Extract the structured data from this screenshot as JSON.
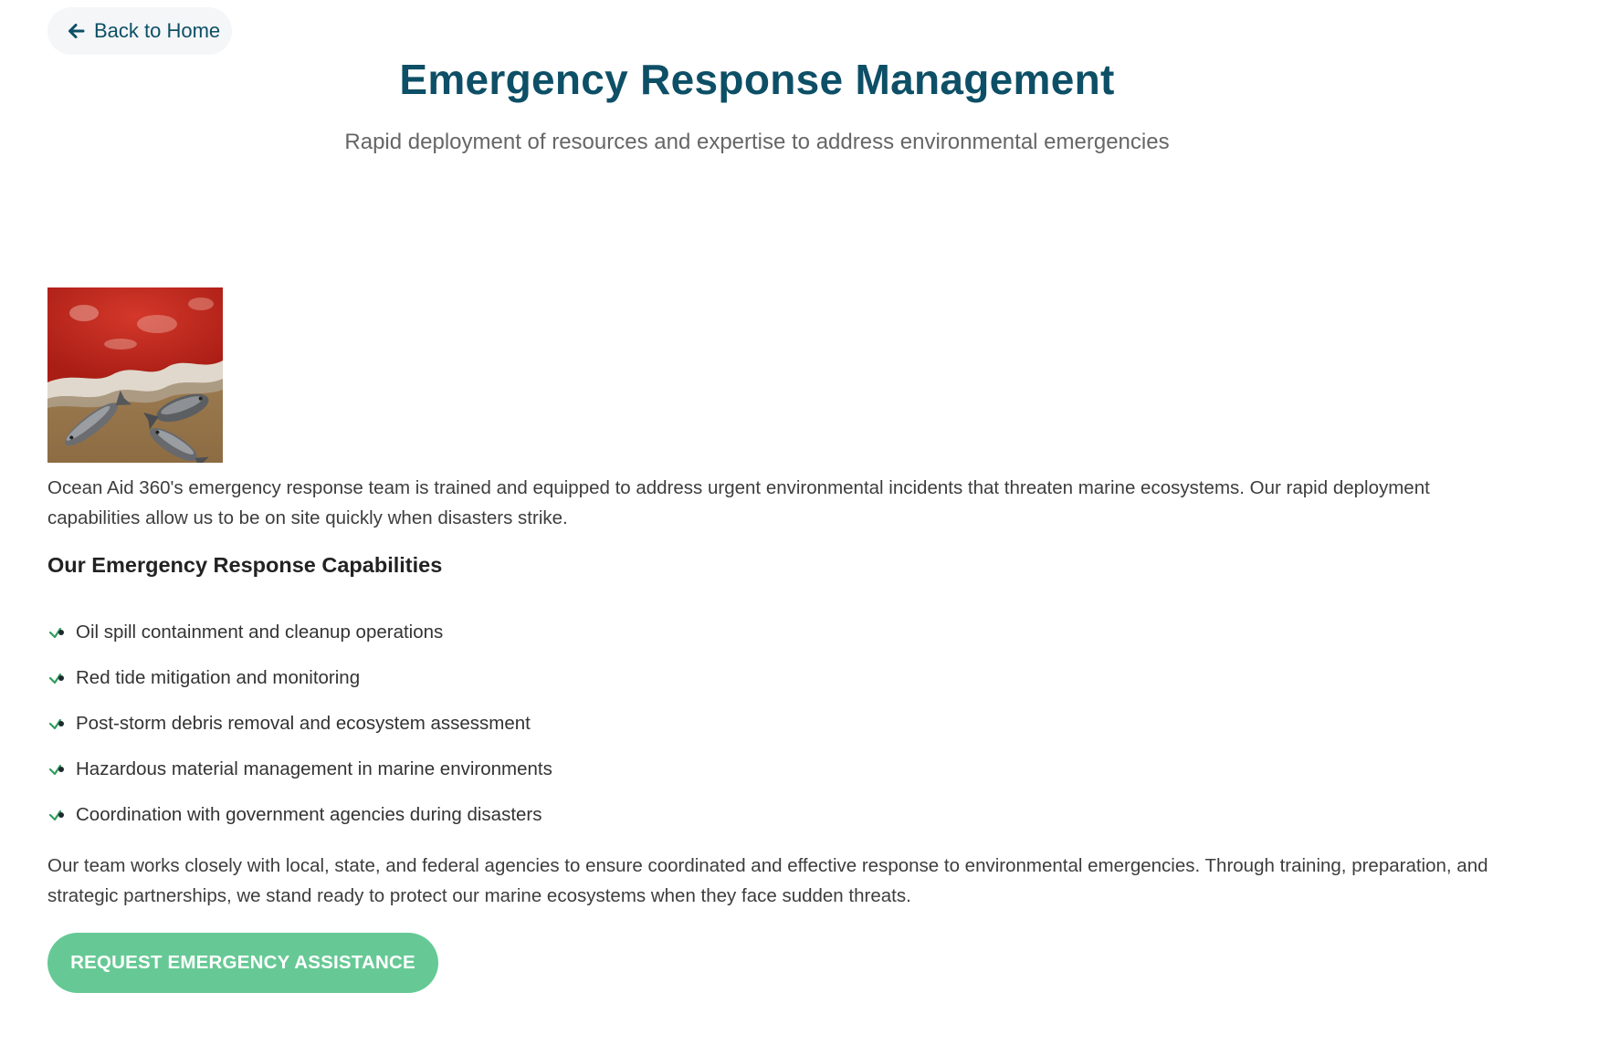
{
  "nav": {
    "back_label": "Back to Home",
    "back_icon": "arrow-left-icon"
  },
  "header": {
    "title": "Emergency Response Management",
    "subtitle": "Rapid deployment of resources and expertise to address environmental emergencies"
  },
  "main": {
    "image_subject": "red tide on beach with dead fish",
    "intro": "Ocean Aid 360's emergency response team is trained and equipped to address urgent environmental incidents that threaten marine ecosystems. Our rapid deployment capabilities allow us to be on site quickly when disasters strike.",
    "capabilities_heading": "Our Emergency Response Capabilities",
    "capabilities": [
      "Oil spill containment and cleanup operations",
      "Red tide mitigation and monitoring",
      "Post-storm debris removal and ecosystem assessment",
      "Hazardous material management in marine environments",
      "Coordination with government agencies during disasters"
    ],
    "capability_icon": "check-icon",
    "closing": "Our team works closely with local, state, and federal agencies to ensure coordinated and effective response to environmental emergencies. Through training, preparation, and strategic partnerships, we stand ready to protect our marine ecosystems when they face sudden threats.",
    "cta_label": "REQUEST EMERGENCY ASSISTANCE"
  },
  "colors": {
    "title": "#0d4f66",
    "cta_background": "#66c995",
    "check": "#2f9d5e"
  }
}
